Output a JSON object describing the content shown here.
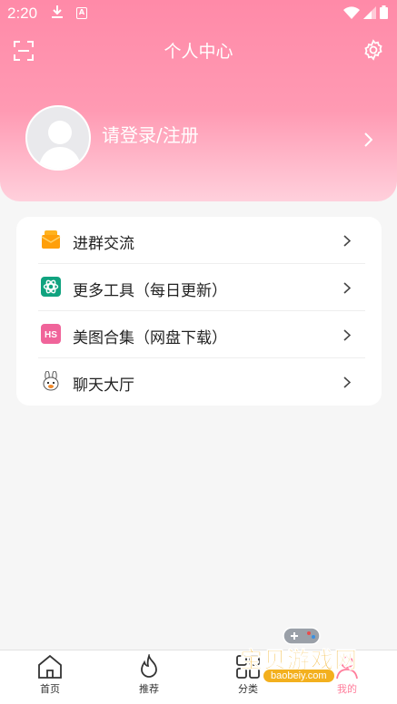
{
  "status_bar": {
    "time": "2:20",
    "icons": [
      "download-icon",
      "a-box-icon",
      "wifi-icon",
      "signal-icon",
      "battery-icon"
    ],
    "a_icon_text": "A"
  },
  "header": {
    "title": "个人中心",
    "left_icon": "scan-icon",
    "right_icon": "gear-icon",
    "gradient": [
      "#ff8aa8",
      "#ffd0dc"
    ]
  },
  "profile": {
    "login_text": "请登录/注册"
  },
  "menu": {
    "items": [
      {
        "label": "进群交流",
        "icon": "group-chat-icon"
      },
      {
        "label": "更多工具（每日更新）",
        "icon": "openai-icon"
      },
      {
        "label": "美图合集（网盘下载）",
        "icon": "hs-icon"
      },
      {
        "label": "聊天大厅",
        "icon": "bunny-icon"
      }
    ],
    "hs_icon_text": "HS"
  },
  "tabbar": {
    "tabs": [
      {
        "label": "首页",
        "icon": "home-icon"
      },
      {
        "label": "推荐",
        "icon": "flame-icon"
      },
      {
        "label": "分类",
        "icon": "grid-icon"
      },
      {
        "label": "我的",
        "icon": "user-icon",
        "active": true
      }
    ],
    "active_color": "#ff7d9b"
  },
  "watermark": {
    "title": "宝贝游戏网",
    "url": "baobeiy.com"
  }
}
